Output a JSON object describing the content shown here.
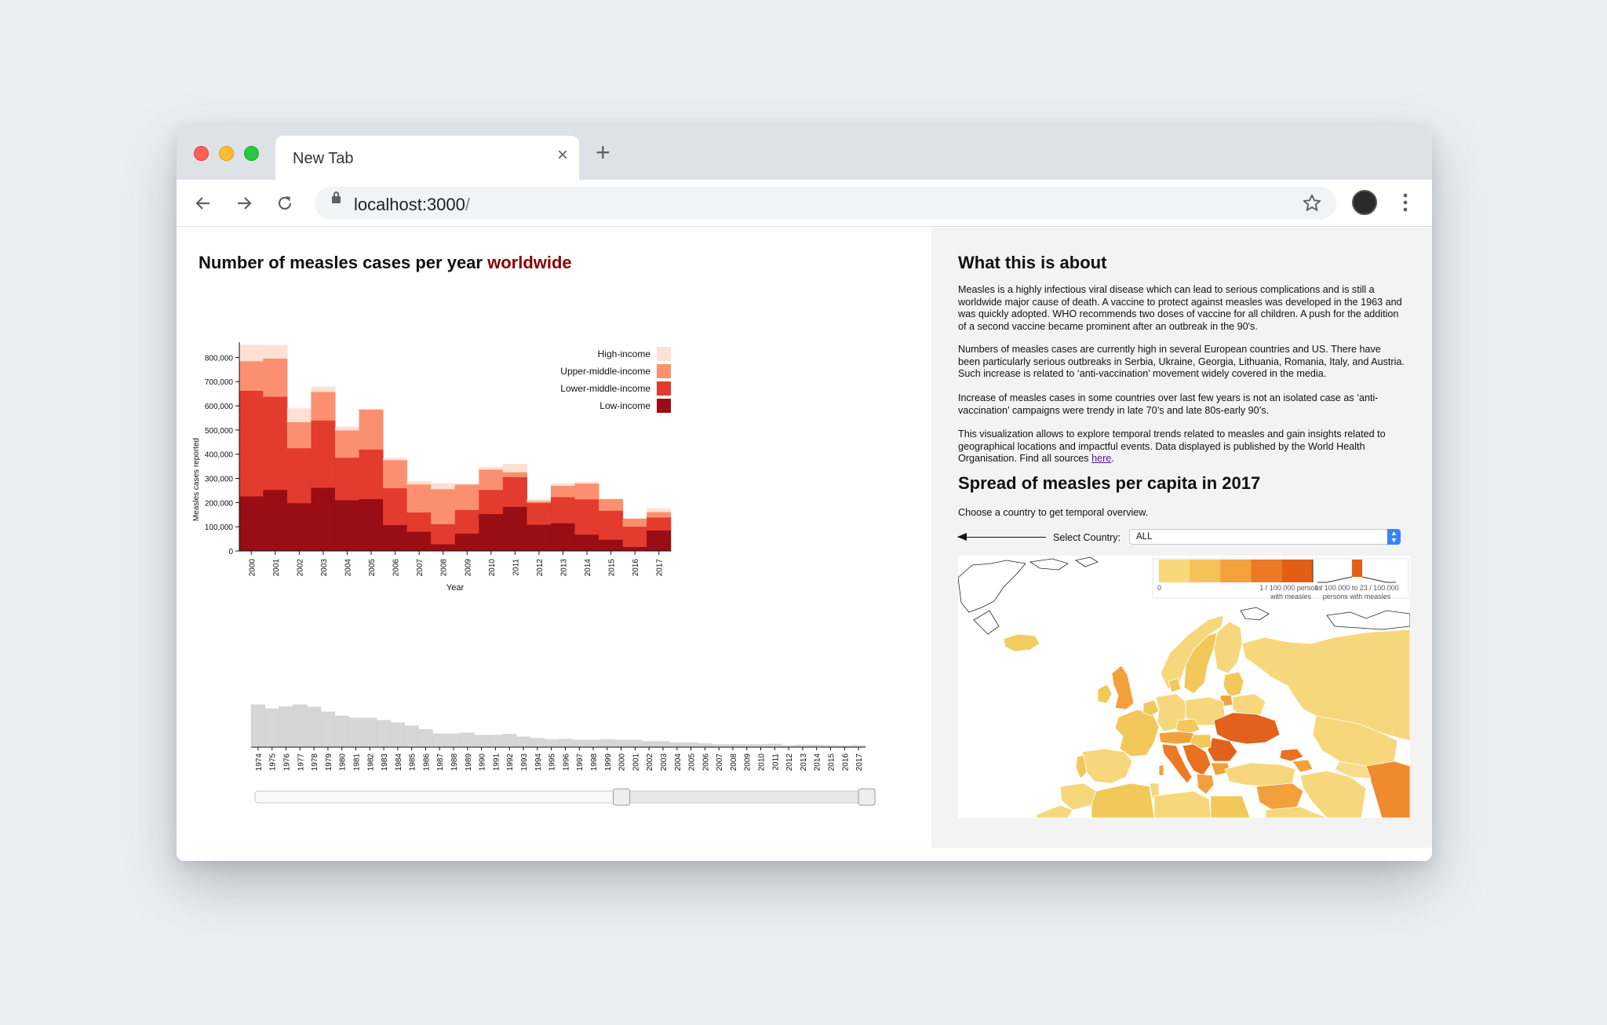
{
  "browser": {
    "tab_title": "New Tab",
    "tab_close": "×",
    "new_tab": "+",
    "url_host": "localhost:3000",
    "url_path": "/",
    "icons": [
      "back-icon",
      "forward-icon",
      "reload-icon",
      "lock-icon",
      "star-icon",
      "avatar",
      "kebab-menu-icon"
    ]
  },
  "left": {
    "title_main": "Number of measles cases per year ",
    "title_accent": "worldwide"
  },
  "chart_data": [
    {
      "type": "bar",
      "stacked": true,
      "ylabel": "Measles cases reported",
      "xlabel": "Year",
      "ylim": [
        0,
        850000
      ],
      "yticks": [
        "0",
        "100,000",
        "200,000",
        "300,000",
        "400,000",
        "500,000",
        "600,000",
        "700,000",
        "800,000"
      ],
      "ytick_values": [
        0,
        100000,
        200000,
        300000,
        400000,
        500000,
        600000,
        700000,
        800000
      ],
      "categories": [
        "2000",
        "2001",
        "2002",
        "2003",
        "2004",
        "2005",
        "2006",
        "2007",
        "2008",
        "2009",
        "2010",
        "2011",
        "2012",
        "2013",
        "2014",
        "2015",
        "2016",
        "2017"
      ],
      "series": [
        {
          "name": "Low-income",
          "color": "#990d14",
          "values": [
            226000,
            253000,
            198000,
            262000,
            210000,
            215000,
            108000,
            80000,
            28000,
            72000,
            153000,
            183000,
            109000,
            115000,
            68000,
            47000,
            17000,
            85000
          ]
        },
        {
          "name": "Lower-middle-income",
          "color": "#e33b2e",
          "values": [
            437000,
            385000,
            227000,
            278000,
            176000,
            205000,
            152000,
            80000,
            83000,
            98000,
            100000,
            123000,
            90000,
            108000,
            146000,
            120000,
            84000,
            54000
          ]
        },
        {
          "name": "Upper-middle-income",
          "color": "#fb9070",
          "values": [
            122000,
            158000,
            108000,
            118000,
            113000,
            165000,
            116000,
            116000,
            145000,
            105000,
            84000,
            20000,
            7000,
            47000,
            65000,
            47000,
            32000,
            22000
          ]
        },
        {
          "name": "High-income",
          "color": "#fee0d4",
          "values": [
            66000,
            54000,
            56000,
            20000,
            14000,
            2000,
            7000,
            12000,
            23000,
            2000,
            10000,
            33000,
            8000,
            8000,
            6000,
            0,
            0,
            14000
          ]
        }
      ],
      "legend": "top-right"
    },
    {
      "type": "bar",
      "role": "overview-brush",
      "categories": [
        "1974",
        "1975",
        "1976",
        "1977",
        "1978",
        "1979",
        "1980",
        "1981",
        "1982",
        "1983",
        "1984",
        "1985",
        "1986",
        "1987",
        "1988",
        "1989",
        "1990",
        "1991",
        "1992",
        "1993",
        "1994",
        "1995",
        "1996",
        "1997",
        "1998",
        "1999",
        "2000",
        "2001",
        "2002",
        "2003",
        "2004",
        "2005",
        "2006",
        "2007",
        "2008",
        "2009",
        "2010",
        "2011",
        "2012",
        "2013",
        "2014",
        "2015",
        "2016",
        "2017"
      ],
      "values": [
        0.95,
        0.86,
        0.91,
        0.95,
        0.9,
        0.79,
        0.7,
        0.65,
        0.65,
        0.6,
        0.55,
        0.48,
        0.4,
        0.3,
        0.3,
        0.32,
        0.27,
        0.27,
        0.29,
        0.23,
        0.2,
        0.17,
        0.18,
        0.16,
        0.16,
        0.17,
        0.16,
        0.16,
        0.13,
        0.13,
        0.1,
        0.1,
        0.08,
        0.06,
        0.06,
        0.06,
        0.06,
        0.07,
        0.04,
        0.05,
        0.05,
        0.04,
        0.03,
        0.04
      ],
      "brush": {
        "from": "2000",
        "to": "2017"
      }
    }
  ],
  "right": {
    "about_title": "What this is about",
    "p1": "Measles is a highly infectious viral disease which can lead to serious complications and is still a worldwide major cause of death. A vaccine to protect against measles was developed in the 1963 and was quickly adopted. WHO recommends two doses of vaccine for all children. A push for the addition of a second vaccine became prominent after an outbreak in the 90's.",
    "p2": "Numbers of measles cases are currently high in several European countries and US. There have been particularly serious outbreaks in Serbia, Ukraine, Georgia, Lithuania, Romania, Italy, and Austria. Such increase is related to ‘anti-vaccination’ movement widely covered in the media.",
    "p3": "Increase of measles cases in some countries over last few years is not an isolated case as ‘anti-vaccination’ campaigns were trendy in late 70’s and late 80s-early 90’s.",
    "p4_text": "This visualization allows to explore temporal trends related to measles and gain insights related to geographical locations and impactful events. Data displayed is published by the World Health Organisation. Find all sources ",
    "p4_link": "here",
    "p4_end": ".",
    "spread_title": "Spread of measles per capita in 2017",
    "choose": "Choose a country to get temporal overview.",
    "select_label": "Select Country:",
    "select_value": "ALL",
    "map_legend": {
      "scale_min": "0",
      "scale_max_line1": "1 / 100.000 persons",
      "scale_max_line2": "with measles",
      "range_line1": "1 / 100.000  to 23 / 100.000",
      "range_line2": "persons with measles",
      "colors": [
        "#f8d77a",
        "#f5c25a",
        "#f3a13a",
        "#ec7a24",
        "#e35e14"
      ]
    }
  }
}
